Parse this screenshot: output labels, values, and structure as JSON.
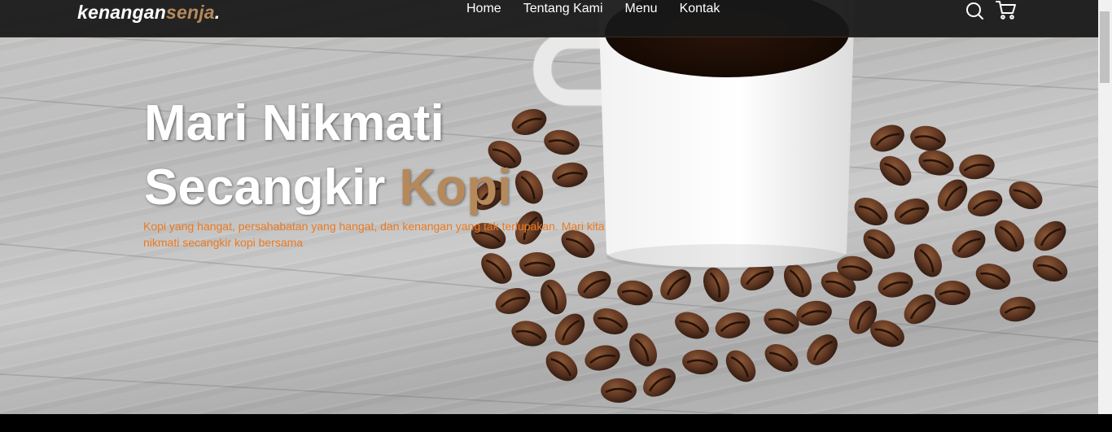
{
  "brand": {
    "name_main": "kenangan",
    "name_accent": "senja",
    "name_dot": "."
  },
  "nav": {
    "links": [
      {
        "label": "Home"
      },
      {
        "label": "Tentang Kami"
      },
      {
        "label": "Menu"
      },
      {
        "label": "Kontak"
      }
    ],
    "icons": [
      "search-icon",
      "shopping-cart-icon"
    ]
  },
  "hero": {
    "title_line1": "Mari Nikmati",
    "title_line2_main": "Secangkir ",
    "title_line2_accent": "Kopi",
    "description": "Kopi yang hangat, persahabatan yang hangat, dan kenangan yang tak terlupakan. Mari kita nikmati secangkir kopi bersama"
  },
  "colors": {
    "accent": "#b6895b",
    "description": "#ea7a22",
    "navbar": "#181818"
  }
}
